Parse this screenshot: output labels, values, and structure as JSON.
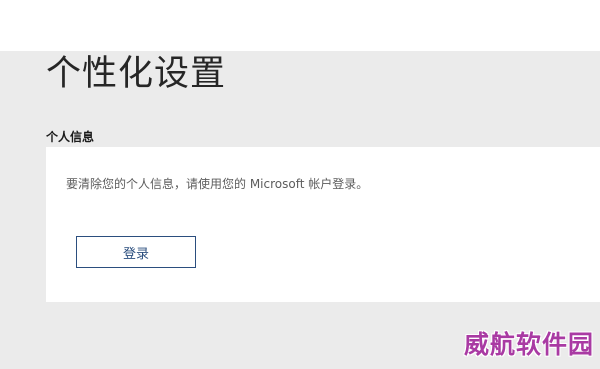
{
  "page": {
    "title": "个性化设置"
  },
  "personal_info": {
    "heading": "个人信息",
    "message": "要清除您的个人信息，请使用您的 Microsoft 帐户登录。",
    "signin_label": "登录"
  },
  "watermark": {
    "text": "威航软件园"
  },
  "colors": {
    "background": "#ebebeb",
    "card": "#ffffff",
    "accent": "#2b4e7e",
    "watermark": "#a93aa3"
  }
}
